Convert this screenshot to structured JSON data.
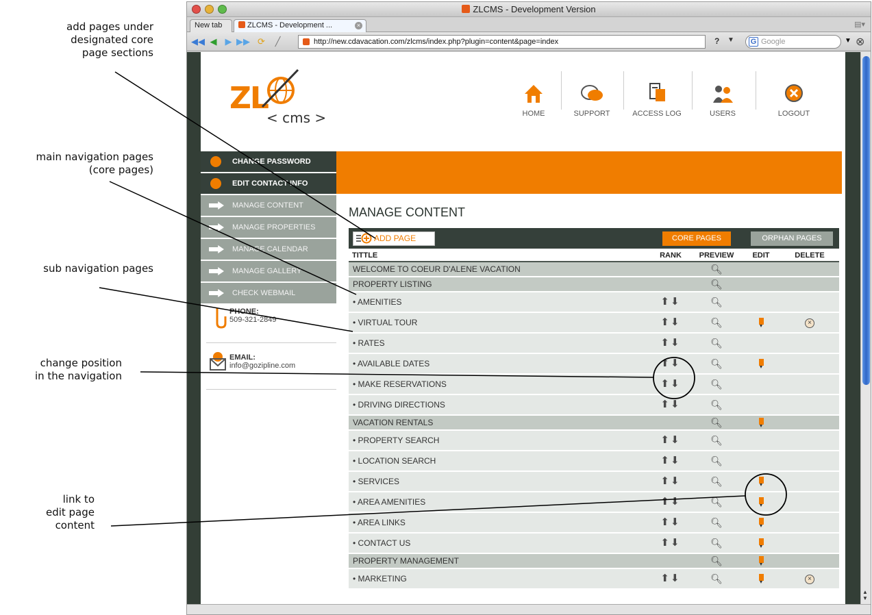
{
  "annotations": {
    "add_pages": "add pages under\ndesignated core\npage sections",
    "main_nav": "main navigation pages\n(core pages)",
    "sub_nav": "sub navigation pages",
    "change_pos": "change position\nin the navigation",
    "edit_link": "link to\nedit page\ncontent"
  },
  "browser": {
    "window_title": "ZLCMS - Development Version",
    "tabs": [
      "New tab",
      "ZLCMS - Development ..."
    ],
    "url": "http://new.cdavacation.com/zlcms/index.php?plugin=content&page=index",
    "search_placeholder": "Google",
    "help_glyph": "?"
  },
  "logo": {
    "mark": "ZL",
    "sub": "< cms >"
  },
  "topnav": [
    {
      "label": "HOME",
      "icon": "home-icon"
    },
    {
      "label": "SUPPORT",
      "icon": "speech-bubble-icon"
    },
    {
      "label": "ACCESS LOG",
      "icon": "document-icon"
    },
    {
      "label": "USERS",
      "icon": "users-icon"
    },
    {
      "label": "LOGOUT",
      "icon": "logout-icon"
    }
  ],
  "sidebar": {
    "items": [
      {
        "label": "CHANGE PASSWORD",
        "icon": "key-icon"
      },
      {
        "label": "EDIT CONTACT INFO",
        "icon": "info-icon"
      },
      {
        "label": "MANAGE CONTENT",
        "icon": "arrow-icon"
      },
      {
        "label": "MANAGE PROPERTIES",
        "icon": "arrow-icon"
      },
      {
        "label": "MANAGE CALENDAR",
        "icon": "arrow-icon"
      },
      {
        "label": "MANAGE GALLERY",
        "icon": "arrow-icon"
      },
      {
        "label": "CHECK WEBMAIL",
        "icon": "arrow-icon"
      }
    ],
    "phone_label": "PHONE:",
    "phone": "509-321-2849",
    "email_label": "EMAIL:",
    "email": "info@gozipline.com"
  },
  "content": {
    "heading": "MANAGE CONTENT",
    "add_page": "ADD PAGE",
    "core_tab": "CORE PAGES",
    "orphan_tab": "ORPHAN PAGES",
    "columns": [
      "TITTLE",
      "RANK",
      "PREVIEW",
      "EDIT",
      "DELETE"
    ],
    "rows": [
      {
        "title": "WELCOME TO COEUR D'ALENE VACATION",
        "core": true,
        "rank": false,
        "edit": false,
        "del": false
      },
      {
        "title": "PROPERTY LISTING",
        "core": true,
        "rank": false,
        "edit": false,
        "del": false
      },
      {
        "title": "• AMENITIES",
        "core": false,
        "rank": true,
        "edit": false,
        "del": false
      },
      {
        "title": "• VIRTUAL TOUR",
        "core": false,
        "rank": true,
        "edit": true,
        "del": true
      },
      {
        "title": "• RATES",
        "core": false,
        "rank": true,
        "edit": false,
        "del": false
      },
      {
        "title": "• AVAILABLE DATES",
        "core": false,
        "rank": true,
        "edit": true,
        "del": false
      },
      {
        "title": "• MAKE RESERVATIONS",
        "core": false,
        "rank": true,
        "edit": false,
        "del": false
      },
      {
        "title": "• DRIVING DIRECTIONS",
        "core": false,
        "rank": true,
        "edit": false,
        "del": false
      },
      {
        "title": "VACATION RENTALS",
        "core": true,
        "rank": false,
        "edit": true,
        "del": false
      },
      {
        "title": "• PROPERTY SEARCH",
        "core": false,
        "rank": true,
        "edit": false,
        "del": false
      },
      {
        "title": "• LOCATION SEARCH",
        "core": false,
        "rank": true,
        "edit": false,
        "del": false
      },
      {
        "title": "• SERVICES",
        "core": false,
        "rank": true,
        "edit": true,
        "del": false
      },
      {
        "title": "• AREA AMENITIES",
        "core": false,
        "rank": true,
        "edit": true,
        "del": false
      },
      {
        "title": "• AREA LINKS",
        "core": false,
        "rank": true,
        "edit": true,
        "del": false
      },
      {
        "title": "• CONTACT US",
        "core": false,
        "rank": true,
        "edit": true,
        "del": false
      },
      {
        "title": "PROPERTY MANAGEMENT",
        "core": true,
        "rank": false,
        "edit": true,
        "del": false
      },
      {
        "title": "• MARKETING",
        "core": false,
        "rank": true,
        "edit": true,
        "del": true
      }
    ]
  },
  "colors": {
    "orange": "#f07d00",
    "dark": "#35403a",
    "grey": "#9aa39c"
  }
}
